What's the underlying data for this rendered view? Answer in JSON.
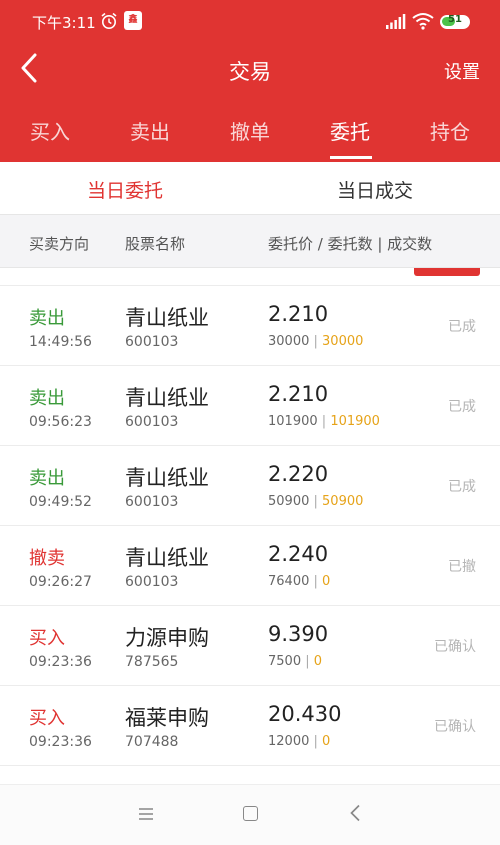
{
  "status": {
    "time": "下午3:11",
    "battery": "51",
    "battery_level": 0.51
  },
  "app_badge": "鑫",
  "nav": {
    "title": "交易",
    "settings": "设置"
  },
  "tabs": [
    "买入",
    "卖出",
    "撤单",
    "委托",
    "持仓"
  ],
  "active_tab": "委托",
  "sub_tabs": {
    "left": "当日委托",
    "right": "当日成交"
  },
  "columns": {
    "direction": "买卖方向",
    "name": "股票名称",
    "price_qty": "委托价 / 委托数 | 成交数"
  },
  "rows": [
    {
      "dir": "卖出",
      "type": "sell",
      "time": "14:49:56",
      "name": "青山纸业",
      "code": "600103",
      "price": "2.210",
      "qty": "30000",
      "filled": "30000",
      "status": "已成"
    },
    {
      "dir": "卖出",
      "type": "sell",
      "time": "09:56:23",
      "name": "青山纸业",
      "code": "600103",
      "price": "2.210",
      "qty": "101900",
      "filled": "101900",
      "status": "已成"
    },
    {
      "dir": "卖出",
      "type": "sell",
      "time": "09:49:52",
      "name": "青山纸业",
      "code": "600103",
      "price": "2.220",
      "qty": "50900",
      "filled": "50900",
      "status": "已成"
    },
    {
      "dir": "撤卖",
      "type": "cancel",
      "time": "09:26:27",
      "name": "青山纸业",
      "code": "600103",
      "price": "2.240",
      "qty": "76400",
      "filled": "0",
      "status": "已撤"
    },
    {
      "dir": "买入",
      "type": "buy",
      "time": "09:23:36",
      "name": "力源申购",
      "code": "787565",
      "price": "9.390",
      "qty": "7500",
      "filled": "0",
      "status": "已确认"
    },
    {
      "dir": "买入",
      "type": "buy",
      "time": "09:23:36",
      "name": "福莱申购",
      "code": "707488",
      "price": "20.430",
      "qty": "12000",
      "filled": "0",
      "status": "已确认"
    }
  ],
  "separator": "|",
  "colors": {
    "brand_red": "#e03432",
    "sell_green": "#3a9a3a",
    "filled_amber": "#e6a319"
  },
  "icons": {
    "back": "back-arrow-icon",
    "alarm": "alarm-clock-icon",
    "signal": "signal-icon",
    "wifi": "wifi-icon",
    "menu": "menu-icon",
    "home": "home-icon",
    "nav_back": "nav-back-icon"
  }
}
